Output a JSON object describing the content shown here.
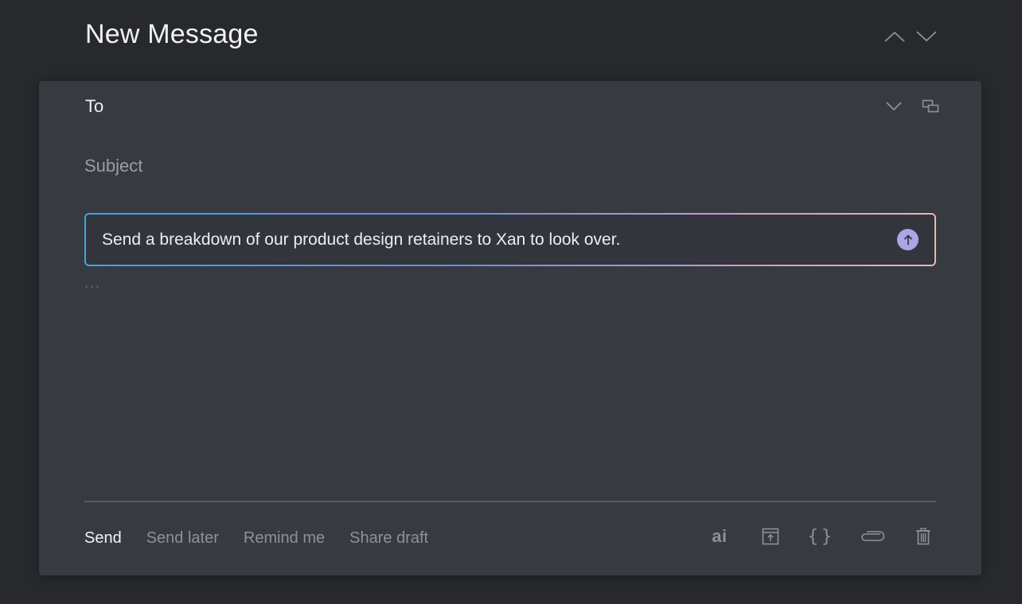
{
  "header": {
    "title": "New Message",
    "nav": [
      "chevron-up-icon",
      "chevron-down-icon"
    ]
  },
  "compose": {
    "to_label": "To",
    "subject_placeholder": "Subject",
    "prompt_text": "Send a breakdown of our product design retainers to Xan to look over.",
    "body_ellipsis": "...",
    "to_actions": [
      "chevron-down-icon",
      "expand-window-icon"
    ]
  },
  "footer": {
    "send_label": "Send",
    "send_later_label": "Send later",
    "remind_me_label": "Remind me",
    "share_draft_label": "Share draft",
    "ai_label": "ai",
    "braces_label": "{}",
    "tools": [
      "ai-icon",
      "archive-upload-icon",
      "braces-icon",
      "paperclip-icon",
      "trash-icon"
    ]
  },
  "colors": {
    "background": "#27292d",
    "panel": "#373a41",
    "accent_submit": "#a9a7e6",
    "gradient_start": "#3aa6e6",
    "gradient_end": "#e8b7b0"
  }
}
